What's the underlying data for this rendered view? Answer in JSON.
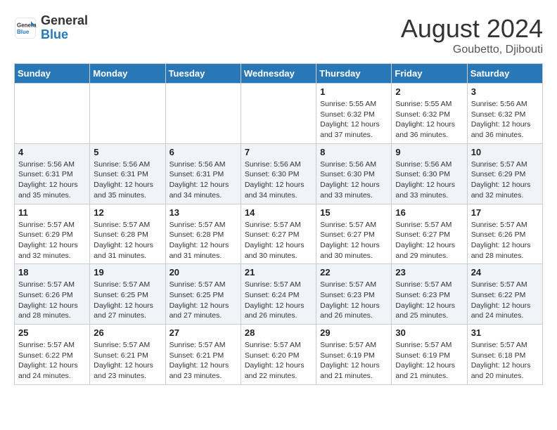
{
  "header": {
    "logo_general": "General",
    "logo_blue": "Blue",
    "month_year": "August 2024",
    "location": "Goubetto, Djibouti"
  },
  "weekdays": [
    "Sunday",
    "Monday",
    "Tuesday",
    "Wednesday",
    "Thursday",
    "Friday",
    "Saturday"
  ],
  "weeks": [
    [
      {
        "day": "",
        "info": ""
      },
      {
        "day": "",
        "info": ""
      },
      {
        "day": "",
        "info": ""
      },
      {
        "day": "",
        "info": ""
      },
      {
        "day": "1",
        "info": "Sunrise: 5:55 AM\nSunset: 6:32 PM\nDaylight: 12 hours\nand 37 minutes."
      },
      {
        "day": "2",
        "info": "Sunrise: 5:55 AM\nSunset: 6:32 PM\nDaylight: 12 hours\nand 36 minutes."
      },
      {
        "day": "3",
        "info": "Sunrise: 5:56 AM\nSunset: 6:32 PM\nDaylight: 12 hours\nand 36 minutes."
      }
    ],
    [
      {
        "day": "4",
        "info": "Sunrise: 5:56 AM\nSunset: 6:31 PM\nDaylight: 12 hours\nand 35 minutes."
      },
      {
        "day": "5",
        "info": "Sunrise: 5:56 AM\nSunset: 6:31 PM\nDaylight: 12 hours\nand 35 minutes."
      },
      {
        "day": "6",
        "info": "Sunrise: 5:56 AM\nSunset: 6:31 PM\nDaylight: 12 hours\nand 34 minutes."
      },
      {
        "day": "7",
        "info": "Sunrise: 5:56 AM\nSunset: 6:30 PM\nDaylight: 12 hours\nand 34 minutes."
      },
      {
        "day": "8",
        "info": "Sunrise: 5:56 AM\nSunset: 6:30 PM\nDaylight: 12 hours\nand 33 minutes."
      },
      {
        "day": "9",
        "info": "Sunrise: 5:56 AM\nSunset: 6:30 PM\nDaylight: 12 hours\nand 33 minutes."
      },
      {
        "day": "10",
        "info": "Sunrise: 5:57 AM\nSunset: 6:29 PM\nDaylight: 12 hours\nand 32 minutes."
      }
    ],
    [
      {
        "day": "11",
        "info": "Sunrise: 5:57 AM\nSunset: 6:29 PM\nDaylight: 12 hours\nand 32 minutes."
      },
      {
        "day": "12",
        "info": "Sunrise: 5:57 AM\nSunset: 6:28 PM\nDaylight: 12 hours\nand 31 minutes."
      },
      {
        "day": "13",
        "info": "Sunrise: 5:57 AM\nSunset: 6:28 PM\nDaylight: 12 hours\nand 31 minutes."
      },
      {
        "day": "14",
        "info": "Sunrise: 5:57 AM\nSunset: 6:27 PM\nDaylight: 12 hours\nand 30 minutes."
      },
      {
        "day": "15",
        "info": "Sunrise: 5:57 AM\nSunset: 6:27 PM\nDaylight: 12 hours\nand 30 minutes."
      },
      {
        "day": "16",
        "info": "Sunrise: 5:57 AM\nSunset: 6:27 PM\nDaylight: 12 hours\nand 29 minutes."
      },
      {
        "day": "17",
        "info": "Sunrise: 5:57 AM\nSunset: 6:26 PM\nDaylight: 12 hours\nand 28 minutes."
      }
    ],
    [
      {
        "day": "18",
        "info": "Sunrise: 5:57 AM\nSunset: 6:26 PM\nDaylight: 12 hours\nand 28 minutes."
      },
      {
        "day": "19",
        "info": "Sunrise: 5:57 AM\nSunset: 6:25 PM\nDaylight: 12 hours\nand 27 minutes."
      },
      {
        "day": "20",
        "info": "Sunrise: 5:57 AM\nSunset: 6:25 PM\nDaylight: 12 hours\nand 27 minutes."
      },
      {
        "day": "21",
        "info": "Sunrise: 5:57 AM\nSunset: 6:24 PM\nDaylight: 12 hours\nand 26 minutes."
      },
      {
        "day": "22",
        "info": "Sunrise: 5:57 AM\nSunset: 6:23 PM\nDaylight: 12 hours\nand 26 minutes."
      },
      {
        "day": "23",
        "info": "Sunrise: 5:57 AM\nSunset: 6:23 PM\nDaylight: 12 hours\nand 25 minutes."
      },
      {
        "day": "24",
        "info": "Sunrise: 5:57 AM\nSunset: 6:22 PM\nDaylight: 12 hours\nand 24 minutes."
      }
    ],
    [
      {
        "day": "25",
        "info": "Sunrise: 5:57 AM\nSunset: 6:22 PM\nDaylight: 12 hours\nand 24 minutes."
      },
      {
        "day": "26",
        "info": "Sunrise: 5:57 AM\nSunset: 6:21 PM\nDaylight: 12 hours\nand 23 minutes."
      },
      {
        "day": "27",
        "info": "Sunrise: 5:57 AM\nSunset: 6:21 PM\nDaylight: 12 hours\nand 23 minutes."
      },
      {
        "day": "28",
        "info": "Sunrise: 5:57 AM\nSunset: 6:20 PM\nDaylight: 12 hours\nand 22 minutes."
      },
      {
        "day": "29",
        "info": "Sunrise: 5:57 AM\nSunset: 6:19 PM\nDaylight: 12 hours\nand 21 minutes."
      },
      {
        "day": "30",
        "info": "Sunrise: 5:57 AM\nSunset: 6:19 PM\nDaylight: 12 hours\nand 21 minutes."
      },
      {
        "day": "31",
        "info": "Sunrise: 5:57 AM\nSunset: 6:18 PM\nDaylight: 12 hours\nand 20 minutes."
      }
    ]
  ]
}
